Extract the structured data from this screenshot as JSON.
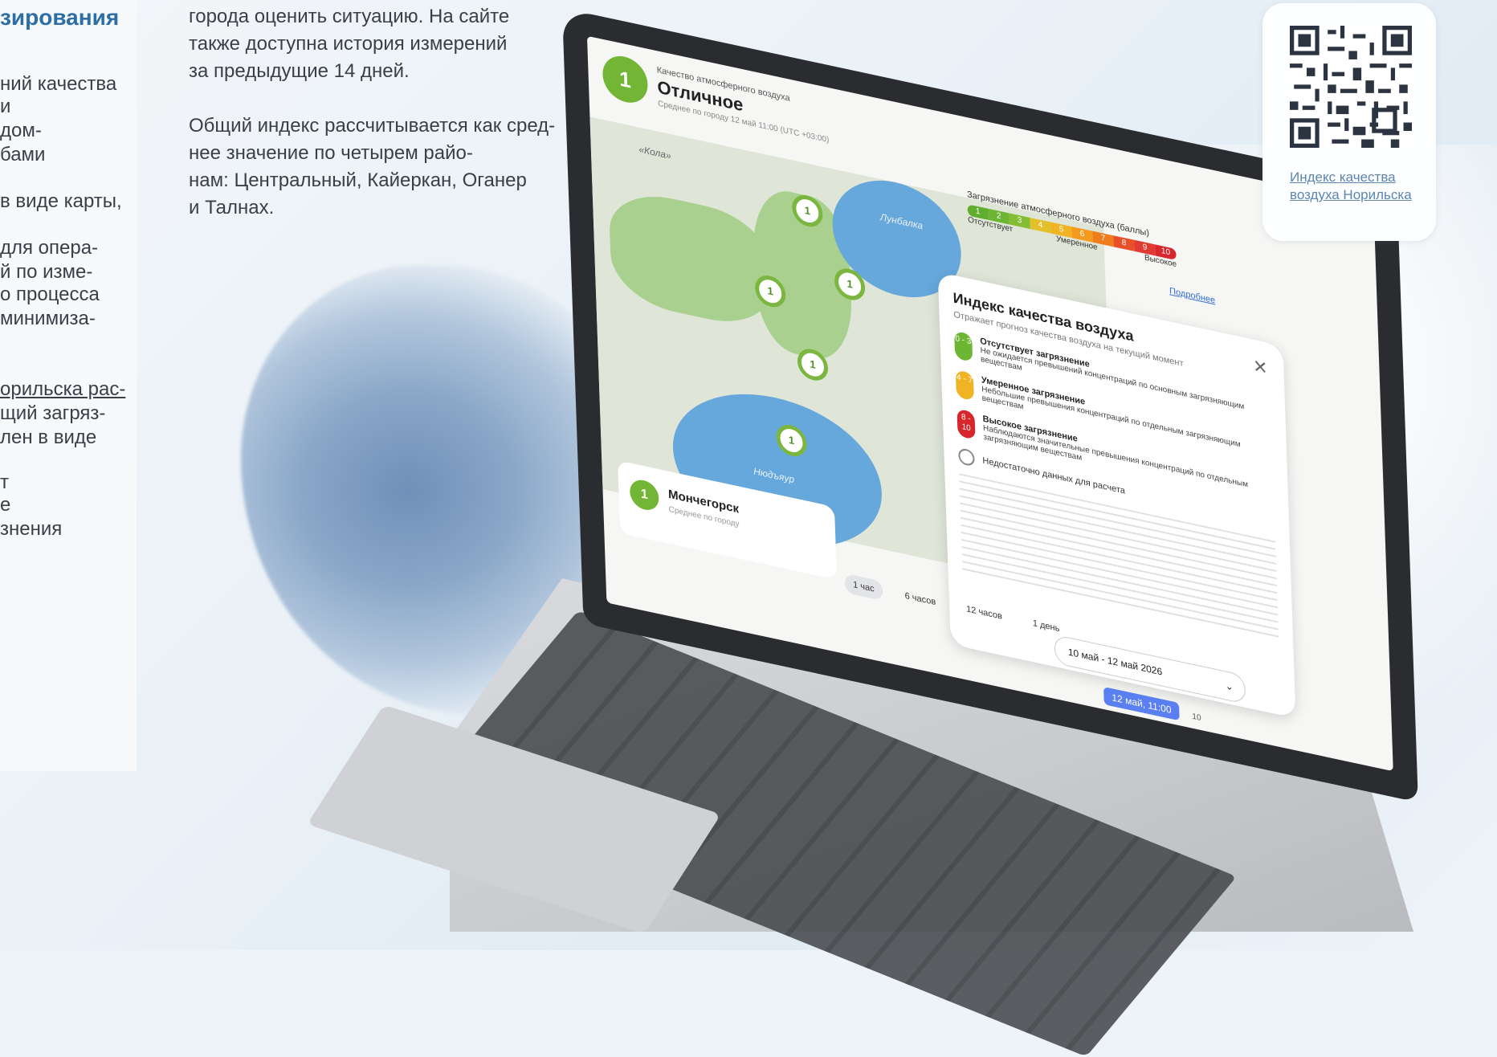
{
  "left_column": {
    "heading": "зирования",
    "lines": [
      "ний качества",
      "и",
      "дом-",
      "бами",
      "в виде карты,",
      "для опера-",
      "й по изме-",
      "о процесса",
      "минимиза-",
      "орильска рас-",
      "щий загряз-",
      "лен в виде",
      "т",
      "е",
      "знения"
    ]
  },
  "middle_column": {
    "paragraph1": [
      "города оценить ситуацию. На сайте",
      "также доступна история измерений",
      "за предыдущие 14 дней."
    ],
    "paragraph2": [
      "Общий индекс рассчитывается как сред-",
      "нее значение по четырем райо-",
      "нам: Центральный, Кайеркан, Оганер",
      "и Талнах."
    ]
  },
  "screen": {
    "index_value": "1",
    "card_label": "Качество атмосферного воздуха",
    "card_title": "Отличное",
    "card_subtitle": "Среднее по городу 12 май 11:00 (UTC +03:00)",
    "scale_title": "Загрязнение атмосферного воздуха (баллы)",
    "scale_values": [
      "1",
      "2",
      "3",
      "4",
      "5",
      "6",
      "7",
      "8",
      "9",
      "10"
    ],
    "scale_colors": [
      "#5fae2e",
      "#6db634",
      "#83bd35",
      "#e3c02b",
      "#f0b323",
      "#f39a1f",
      "#ef7d1d",
      "#e8502a",
      "#e13a32",
      "#d7262c"
    ],
    "scale_low": "Отсутствует",
    "scale_mid": "Умеренное",
    "scale_high": "Высокое",
    "more_link": "Подробнее",
    "lake_1": "Лунбалка",
    "lake_2": "Нюдъяур",
    "road_label": "«Кола»",
    "markers": [
      "1",
      "1",
      "1",
      "1",
      "1"
    ],
    "legend": {
      "title": "Индекс качества воздуха",
      "subtitle": "Отражает прогноз качества воздуха на текущий момент",
      "rows": [
        {
          "range": "0 - 3",
          "color": "#6db634",
          "title": "Отсутствует загрязнение",
          "text": "Не ожидается превышений концентраций по основным загрязняющим веществам"
        },
        {
          "range": "4 - 7",
          "color": "#f0b323",
          "title": "Умеренное загрязнение",
          "text": "Небольшие превышения концентраций по отдельным загрязняющим веществам"
        },
        {
          "range": "8 - 10",
          "color": "#d7262c",
          "title": "Высокое загрязнение",
          "text": "Наблюдаются значительные превышения концентраций по отдельным загрязняющим веществам"
        }
      ],
      "no_data": "Недостаточно данных для расчета"
    },
    "city_card": {
      "value": "1",
      "name": "Мончегорск",
      "subtitle": "Среднее по городу"
    },
    "tabs": [
      "1 час",
      "6 часов",
      "12 часов",
      "1 день"
    ],
    "date_range": "10 май - 12 май 2026",
    "time_pill": "12 май, 11:00",
    "tick": "10"
  },
  "qr_card": {
    "caption": "Индекс качества воздуха Норильска"
  }
}
